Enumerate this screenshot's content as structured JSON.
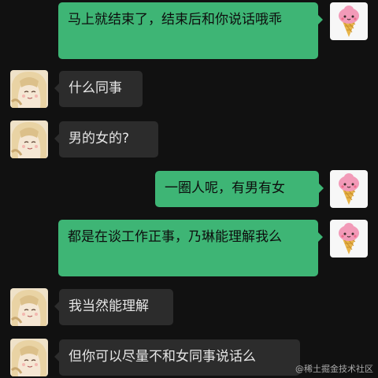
{
  "messages": [
    {
      "side": "sent",
      "text": "马上就结束了，结束后和你说话哦乖",
      "avatar": "ice-cream-avatar"
    },
    {
      "side": "recv",
      "text": "什么同事",
      "avatar": "anime-girl-avatar"
    },
    {
      "side": "recv",
      "text": "男的女的?",
      "avatar": "anime-girl-avatar"
    },
    {
      "side": "sent",
      "text": "一圈人呢，有男有女",
      "avatar": "ice-cream-avatar"
    },
    {
      "side": "sent",
      "text": "都是在谈工作正事，乃琳能理解我么",
      "avatar": "ice-cream-avatar"
    },
    {
      "side": "recv",
      "text": "我当然能理解",
      "avatar": "anime-girl-avatar"
    },
    {
      "side": "recv",
      "text": "但你可以尽量不和女同事说话么",
      "avatar": "anime-girl-avatar"
    }
  ],
  "watermark": "@稀土掘金技术社区",
  "colors": {
    "background": "#111111",
    "sent_bubble": "#3eb575",
    "recv_bubble": "#2c2c2c"
  }
}
